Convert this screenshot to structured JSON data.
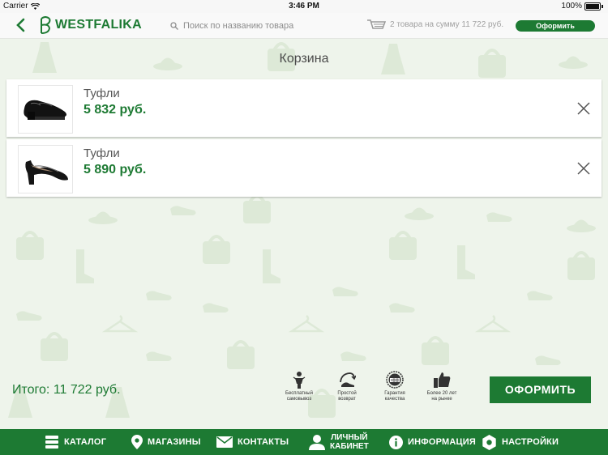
{
  "status_bar": {
    "carrier": "Carrier",
    "time": "3:46 PM",
    "battery": "100%"
  },
  "header": {
    "brand": "WESTFALIKA",
    "search_placeholder": "Поиск по названию товара",
    "cart_summary": "2 товара на сумму 11 722 руб.",
    "order_label": "Оформить"
  },
  "page": {
    "title": "Корзина"
  },
  "cart": {
    "items": [
      {
        "name": "Туфли",
        "price": "5 832 руб."
      },
      {
        "name": "Туфли",
        "price": "5 890 руб."
      }
    ],
    "total": "Итого: 11 722 руб.",
    "checkout_label": "ОФОРМИТЬ"
  },
  "features": [
    {
      "icon": "person-icon",
      "line1": "Бесплатный",
      "line2": "самовывоз"
    },
    {
      "icon": "return-shoe-icon",
      "line1": "Простой",
      "line2": "возврат"
    },
    {
      "icon": "quality-seal-icon",
      "line1": "Гарантия",
      "line2": "качества"
    },
    {
      "icon": "thumbs-up-icon",
      "line1": "Более 20 лет",
      "line2": "на рынке"
    }
  ],
  "nav": {
    "catalog": "КАТАЛОГ",
    "stores": "МАГАЗИНЫ",
    "contacts": "КОНТАКТЫ",
    "account_line1": "ЛИЧНЫЙ",
    "account_line2": "КАБИНЕТ",
    "info": "ИНФОРМАЦИЯ",
    "settings": "НАСТРОЙКИ"
  },
  "colors": {
    "brand_green": "#1d7a33",
    "pattern_bg": "#eef4eb",
    "pattern_shape": "#dde9d7"
  }
}
